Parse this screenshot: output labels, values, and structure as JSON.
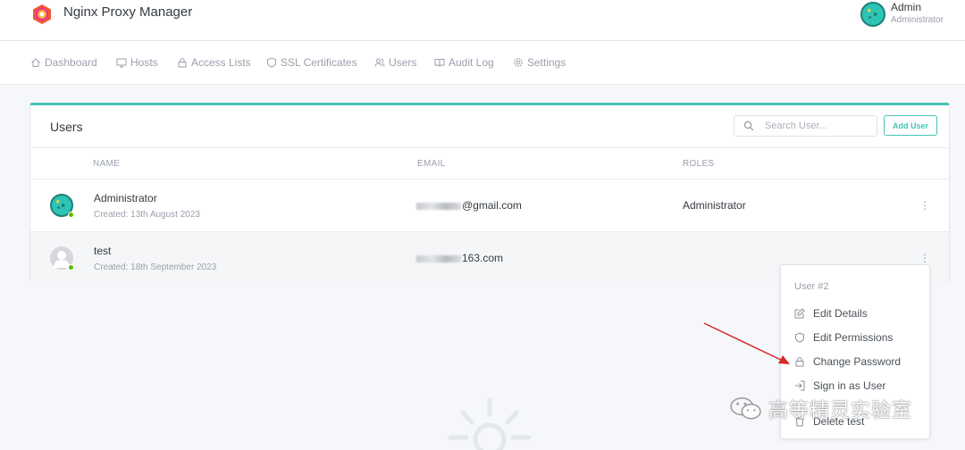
{
  "app": {
    "title": "Nginx Proxy Manager"
  },
  "current_user": {
    "name": "Admin",
    "role": "Administrator"
  },
  "nav": [
    {
      "label": "Dashboard",
      "icon": "home-icon"
    },
    {
      "label": "Hosts",
      "icon": "monitor-icon"
    },
    {
      "label": "Access Lists",
      "icon": "lock-icon"
    },
    {
      "label": "SSL Certificates",
      "icon": "shield-icon"
    },
    {
      "label": "Users",
      "icon": "users-icon"
    },
    {
      "label": "Audit Log",
      "icon": "book-icon"
    },
    {
      "label": "Settings",
      "icon": "gear-icon"
    }
  ],
  "users_card": {
    "title": "Users",
    "search_placeholder": "Search User...",
    "add_button": "Add User",
    "columns": [
      "NAME",
      "EMAIL",
      "ROLES"
    ],
    "rows": [
      {
        "name": "Administrator",
        "created": "Created: 13th August 2023",
        "email_visible": "@gmail.com",
        "roles": "Administrator",
        "online": true
      },
      {
        "name": "test",
        "created": "Created: 18th September 2023",
        "email_visible": "163.com",
        "roles": "",
        "online": true
      }
    ]
  },
  "context_menu": {
    "header": "User #2",
    "items": [
      {
        "label": "Edit Details",
        "icon": "edit-icon"
      },
      {
        "label": "Edit Permissions",
        "icon": "shield-icon"
      },
      {
        "label": "Change Password",
        "icon": "lock-icon"
      },
      {
        "label": "Sign in as User",
        "icon": "sign-in-icon"
      },
      {
        "label": "Delete test",
        "icon": "trash-icon"
      }
    ]
  },
  "watermark": {
    "text": "高等精灵实验室"
  },
  "colors": {
    "accent": "#45c4b8",
    "arrow": "#d42a2a",
    "online": "#5eba00"
  }
}
